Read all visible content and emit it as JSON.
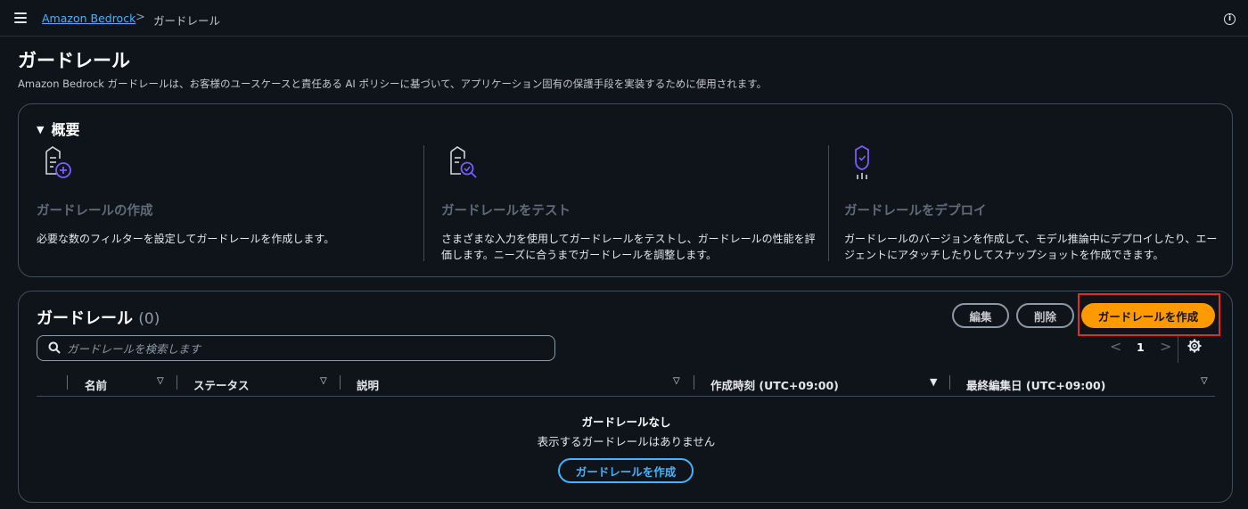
{
  "breadcrumb": {
    "root": "Amazon Bedrock",
    "separator": ">",
    "current": "ガードレール"
  },
  "page": {
    "title": "ガードレール",
    "description": "Amazon Bedrock ガードレールは、お客様のユースケースと責任ある AI ポリシーに基づいて、アプリケーション固有の保護手段を実装するために使用されます。"
  },
  "overview": {
    "header": "概要",
    "caret": "▼",
    "steps": [
      {
        "icon": "shield-document-plus-icon",
        "title": "ガードレールの作成",
        "description": "必要な数のフィルターを設定してガードレールを作成します。"
      },
      {
        "icon": "shield-document-search-icon",
        "title": "ガードレールをテスト",
        "description": "さまざまな入力を使用してガードレールをテストし、ガードレールの性能を評価します。ニーズに合うまでガードレールを調整します。"
      },
      {
        "icon": "shield-deploy-icon",
        "title": "ガードレールをデプロイ",
        "description": "ガードレールのバージョンを作成して、モデル推論中にデプロイしたり、エージェントにアタッチしたりしてスナップショットを作成できます。"
      }
    ]
  },
  "guardrails": {
    "title": "ガードレール",
    "count": "(0)",
    "edit_label": "編集",
    "delete_label": "削除",
    "create_label": "ガードレールを作成",
    "search_placeholder": "ガードレールを検索します",
    "pagination": {
      "prev": "<",
      "current": "1",
      "next": ">"
    },
    "columns": [
      "名前",
      "ステータス",
      "説明",
      "作成時刻 (UTC+09:00)",
      "最終編集日 (UTC+09:00)"
    ],
    "empty_title": "ガードレールなし",
    "empty_description": "表示するガードレールはありません",
    "empty_create_label": "ガードレールを作成"
  },
  "colors": {
    "accent": "#ff9900",
    "link": "#42b4ff",
    "highlight": "#e8291c",
    "background": "#0f141a"
  }
}
